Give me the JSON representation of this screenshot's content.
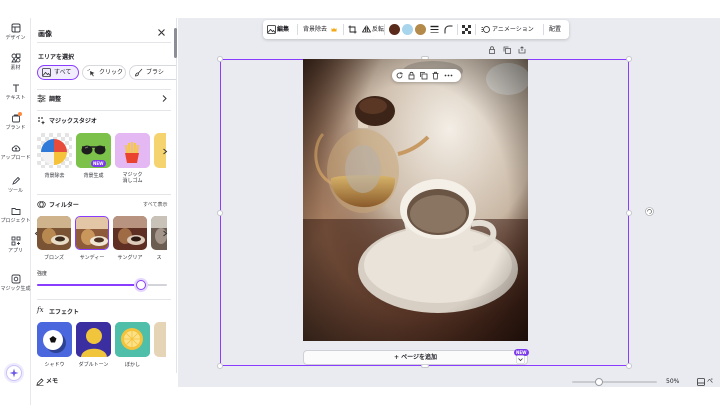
{
  "rail": {
    "items": [
      {
        "label": "デザイン"
      },
      {
        "label": "素材"
      },
      {
        "label": "テキスト"
      },
      {
        "label": "ブランド"
      },
      {
        "label": "アップロード"
      },
      {
        "label": "ツール"
      },
      {
        "label": "プロジェクト"
      },
      {
        "label": "アプリ"
      },
      {
        "label": "マジック生成"
      }
    ]
  },
  "panel": {
    "title": "画像",
    "area_select_label": "エリアを選択",
    "chips": [
      {
        "label": "すべて",
        "selected": true
      },
      {
        "label": "クリック",
        "selected": false
      },
      {
        "label": "ブラシ",
        "selected": false
      }
    ],
    "adjust_label": "調整",
    "magic_studio_label": "マジックスタジオ",
    "magic_items": [
      {
        "label": "背景除去"
      },
      {
        "label": "背景生成",
        "badge": "NEW"
      },
      {
        "label": "マジック\n消しゴム"
      }
    ],
    "filter_label": "フィルター",
    "filter_see_all": "すべて表示",
    "filters": [
      {
        "label": "ブロンズ",
        "selected": false
      },
      {
        "label": "サンディー",
        "selected": true
      },
      {
        "label": "サングリア",
        "selected": false
      },
      {
        "label": "ス",
        "selected": false
      }
    ],
    "intensity_label": "強度",
    "intensity_value": 0.8,
    "effect_label": "エフェクト",
    "effects": [
      {
        "label": "シャドウ"
      },
      {
        "label": "ダブルトーン"
      },
      {
        "label": "ぼかし"
      }
    ]
  },
  "toolbar": {
    "edit_label": "編集",
    "bg_remove_label": "背景除去",
    "flip_label": "反転",
    "colors": [
      "#5a2a1a",
      "#a8d4ec",
      "#b38a4a"
    ],
    "animation_label": "アニメーション",
    "position_label": "配置"
  },
  "canvas": {
    "add_page_label": "+ ページを追加",
    "new_badge": "NEW"
  },
  "bottom": {
    "notes_label": "メモ",
    "zoom_level": "50%",
    "zoom_fraction": 0.32,
    "page_label": "ペ"
  }
}
